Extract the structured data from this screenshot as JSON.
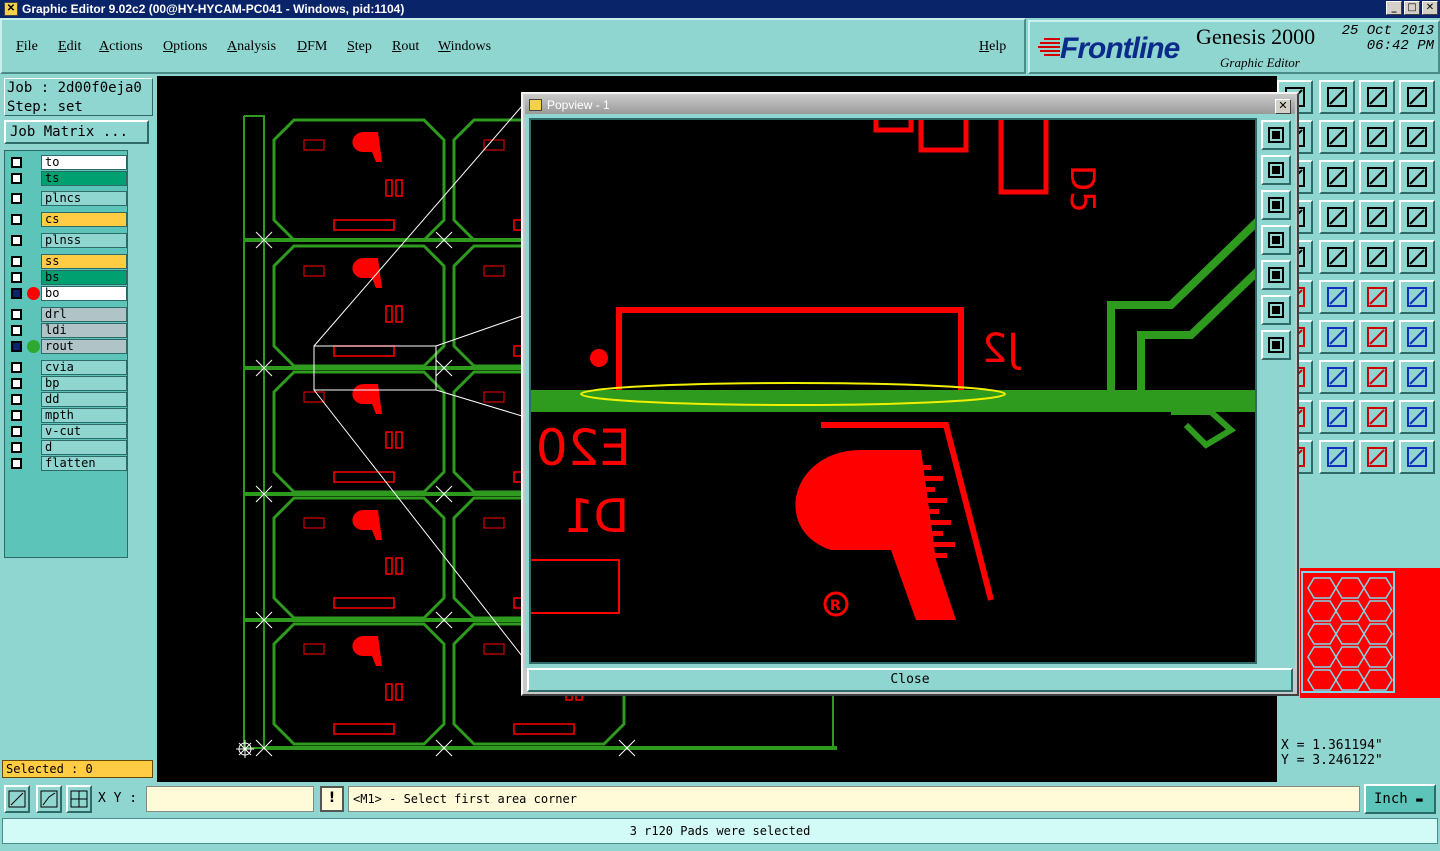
{
  "window": {
    "title": "Graphic Editor 9.02c2 (00@HY-HYCAM-PC041 - Windows, pid:1104)"
  },
  "menu": [
    "File",
    "Edit",
    "Actions",
    "Options",
    "Analysis",
    "DFM",
    "Step",
    "Rout",
    "Windows"
  ],
  "help_label": "Help",
  "logo": {
    "brand": "Frontline",
    "product": "Genesis 2000",
    "subtitle": "Graphic Editor",
    "date": "25 Oct 2013",
    "time": "06:42 PM"
  },
  "job": {
    "job_line": "Job : 2d00f0eja0",
    "step_line": "Step: set",
    "matrix_label": "Job Matrix ..."
  },
  "layers": [
    {
      "name": "to",
      "color": "#ffffff",
      "dot": ""
    },
    {
      "name": "ts",
      "color": "#00a070",
      "dot": ""
    },
    {
      "name": "plncs",
      "color": "#8fd5d0",
      "dot": ""
    },
    {
      "name": "cs",
      "color": "#ffcc44",
      "dot": ""
    },
    {
      "name": "plnss",
      "color": "#8fd5d0",
      "dot": ""
    },
    {
      "name": "ss",
      "color": "#ffcc44",
      "dot": ""
    },
    {
      "name": "bs",
      "color": "#00a070",
      "dot": ""
    },
    {
      "name": "bo",
      "color": "#ffffff",
      "dot": "#ff0000"
    },
    {
      "name": "drl",
      "color": "#b0c4c8",
      "dot": ""
    },
    {
      "name": "ldi",
      "color": "#b0c4c8",
      "dot": ""
    },
    {
      "name": "rout",
      "color": "#b0c4c8",
      "dot": "#2ea82e"
    },
    {
      "name": "cvia",
      "color": "#8fd5d0",
      "dot": ""
    },
    {
      "name": "bp",
      "color": "#8fd5d0",
      "dot": ""
    },
    {
      "name": "dd",
      "color": "#8fd5d0",
      "dot": ""
    },
    {
      "name": "mpth",
      "color": "#8fd5d0",
      "dot": ""
    },
    {
      "name": "v-cut",
      "color": "#8fd5d0",
      "dot": ""
    },
    {
      "name": "d",
      "color": "#8fd5d0",
      "dot": ""
    },
    {
      "name": "flatten",
      "color": "#8fd5d0",
      "dot": ""
    }
  ],
  "selected_label": "Selected : 0",
  "popview": {
    "title": "Popview - 1",
    "close_label": "Close"
  },
  "coords": {
    "x": "X = 1.361194\"",
    "y": "Y = 3.246122\""
  },
  "cmd": {
    "xy_label": "X Y :",
    "xy_value": "",
    "prompt": "<M1> - Select first area corner",
    "unit": "Inch"
  },
  "status": "3 r120 Pads were selected",
  "pcb_labels": {
    "j2": "J2",
    "d5": "D5",
    "d1": "D1",
    "e20": "E20",
    "r": "R"
  },
  "colors": {
    "pcb_red": "#ff0000",
    "pcb_green": "#2e9a1e",
    "panel": "#8fd5d0",
    "highlight": "#f0f000"
  }
}
